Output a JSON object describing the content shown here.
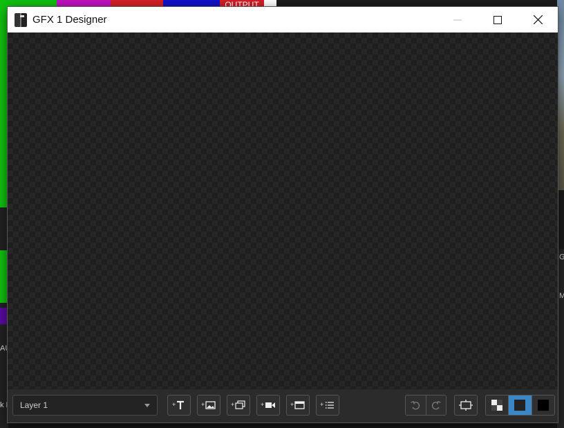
{
  "window": {
    "title": "GFX 1 Designer"
  },
  "background": {
    "output_tab": "OUTPUT",
    "left_label_1": "AU",
    "left_label_2": "k M",
    "right_label_1": "G",
    "right_label_2": "M",
    "bar_colors": [
      "#10c010",
      "#c010c0",
      "#d41f28",
      "#1212cc",
      "#ffffff"
    ]
  },
  "toolbar": {
    "layer_select_value": "Layer 1",
    "buttons": [
      {
        "name": "add-text-button",
        "icon": "add-text-icon"
      },
      {
        "name": "add-image-button",
        "icon": "add-image-icon"
      },
      {
        "name": "add-slideshow-button",
        "icon": "add-slideshow-icon"
      },
      {
        "name": "add-video-button",
        "icon": "add-video-icon"
      },
      {
        "name": "add-window-button",
        "icon": "add-window-icon"
      },
      {
        "name": "add-list-button",
        "icon": "add-list-icon"
      }
    ],
    "undo_icon": "undo-icon",
    "redo_icon": "redo-icon",
    "fit_icon": "fit-canvas-icon",
    "background_modes": [
      "checker",
      "dark",
      "black"
    ],
    "active_background_mode": "dark",
    "accent_color": "#3a86c6"
  }
}
